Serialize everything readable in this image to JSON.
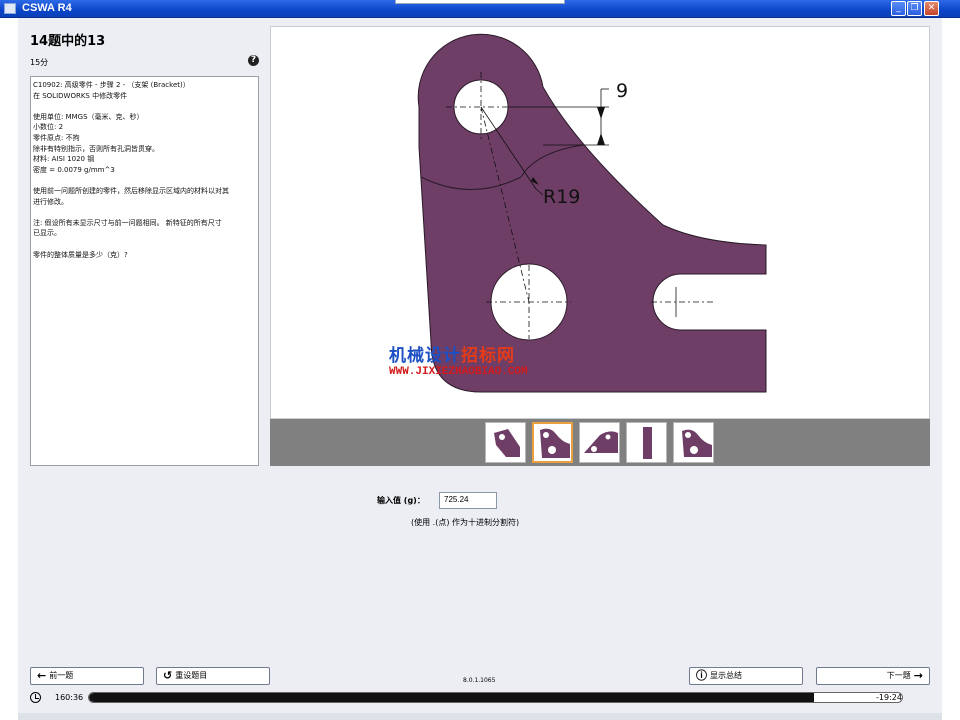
{
  "window": {
    "title": "CSWA R4",
    "controls": {
      "minimize": "_",
      "restore": "❐",
      "close": "✕"
    }
  },
  "question": {
    "header": "14题中的13",
    "points": "15分",
    "help_icon": "help-circle-icon",
    "prompt_lines": [
      "C10902: 高级零件 - 步骤 2 - （支架 (Bracket)）",
      "在 SOLIDWORKS 中修改零件",
      "",
      "使用单位: MMGS（毫米、克、秒）",
      "小数位: 2",
      "零件原点: 不拘",
      "除非有特别指示，否则所有孔洞皆贯穿。",
      "材料: AISI 1020 钢",
      "密度 = 0.0079 g/mm^3",
      "",
      "使用前一问题所创建的零件，然后移除显示区域内的材料以对其",
      "进行修改。",
      "",
      "注: 假设所有未显示尺寸与前一问题相同。 新特征的所有尺寸",
      "已显示。",
      "",
      "零件的整体质量是多少（克）?"
    ]
  },
  "drawing": {
    "dim_distance": "9",
    "dim_radius": "R19",
    "part_color": "#6e3e66",
    "watermark": {
      "cn_part1": "机械设计",
      "cn_part2": "招标网",
      "url": "WWW.JIXIEZHAOBIAO.COM"
    }
  },
  "thumbnails": [
    {
      "label": "view-1"
    },
    {
      "label": "view-2",
      "selected": true
    },
    {
      "label": "view-3"
    },
    {
      "label": "view-4"
    },
    {
      "label": "view-5"
    }
  ],
  "answer": {
    "label": "输入值 (g)：",
    "value": "725.24",
    "hint": "(使用 .(点) 作为十进制分割符)"
  },
  "footer": {
    "prev_label": "前一题",
    "prev_icon": "arrow-left-icon",
    "reset_label": "重设题目",
    "reset_icon": "reset-icon",
    "version": "8.0.1.1065",
    "summary_label": "显示总结",
    "summary_icon": "info-icon",
    "next_label": "下一题",
    "next_icon": "arrow-right-icon"
  },
  "timer": {
    "elapsed": "160:36",
    "remaining": "-19:24",
    "progress_fraction": 0.892
  }
}
